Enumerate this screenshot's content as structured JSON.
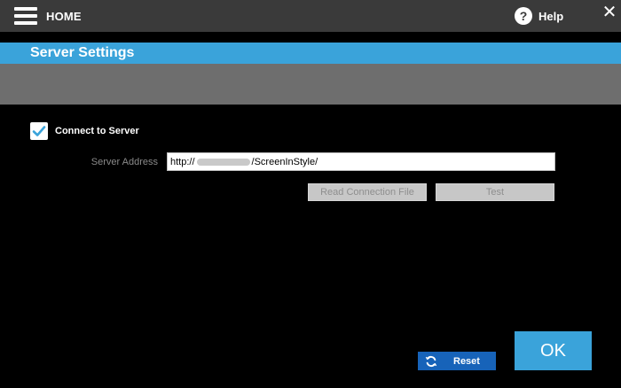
{
  "header": {
    "home_label": "HOME",
    "help_label": "Help",
    "help_icon_glyph": "?",
    "close_glyph": "✕"
  },
  "title": "Server Settings",
  "connect": {
    "label": "Connect to Server",
    "checked": true
  },
  "server": {
    "label": "Server Address",
    "value_prefix": "http://",
    "value_suffix": "/ScreenInStyle/"
  },
  "buttons": {
    "read_connection_file": "Read Connection File",
    "test": "Test",
    "reset": "Reset",
    "ok": "OK"
  },
  "colors": {
    "accent": "#3aa3da",
    "reset_blue": "#1763b9",
    "topbar": "#3a3a3a",
    "gray_band": "#6e6e6e"
  }
}
